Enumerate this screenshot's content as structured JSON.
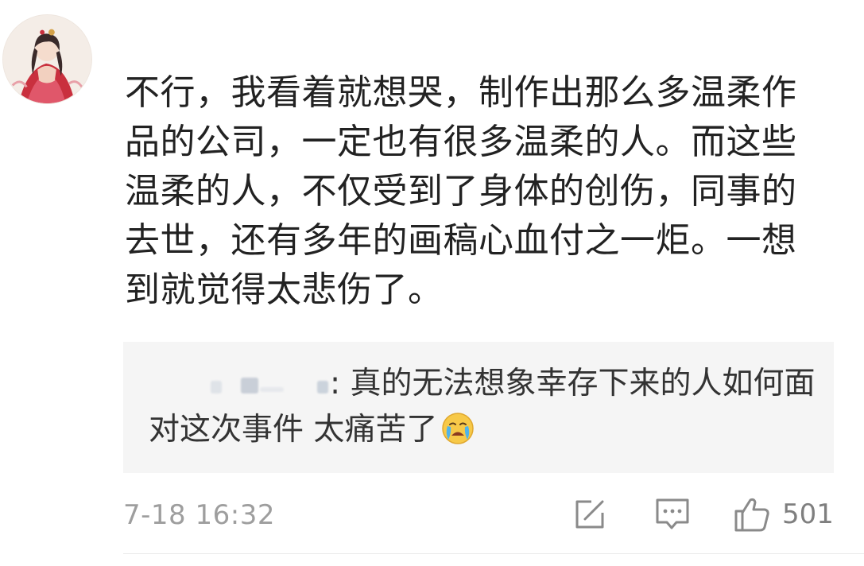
{
  "comment": {
    "avatar_icon": "user-avatar-illustration",
    "body_text": "不行，我看着就想哭，制作出那么多温柔作品的公司，一定也有很多温柔的人。而这些温柔的人，不仅受到了身体的创伤，同事的去世，还有多年的画稿心血付之一炬。一想到就觉得太悲伤了。",
    "reply": {
      "separator": ":",
      "text": " 真的无法想象幸存下来的人如何面对这次事件 太痛苦了",
      "emoji_icon": "crying-face-emoji"
    },
    "timestamp": "7-18 16:32",
    "actions": {
      "share_icon": "share-icon",
      "comment_icon": "comment-icon",
      "like_icon": "thumbs-up-icon",
      "like_count": "501"
    }
  },
  "colors": {
    "text_primary": "#222222",
    "reply_bg": "#f5f5f5",
    "meta_gray": "#9e9e9e",
    "icon_gray": "#8a8a8a"
  }
}
